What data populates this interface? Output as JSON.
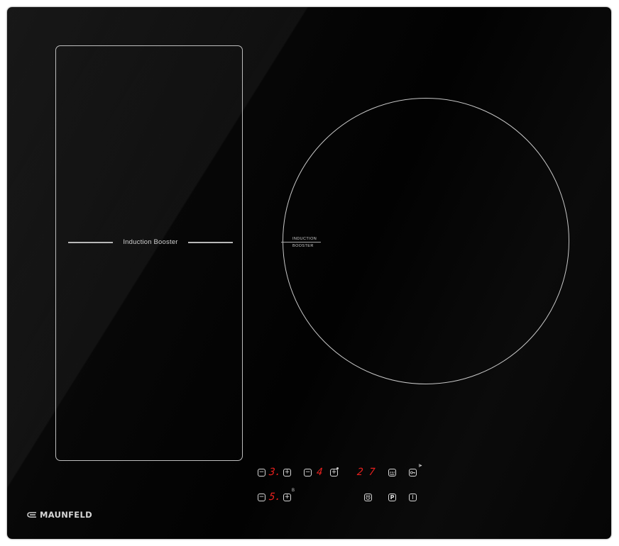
{
  "flex_zone": {
    "label": "Induction Booster"
  },
  "round_zone": {
    "label_line1": "INDUCTION",
    "label_line2": "BOOSTER"
  },
  "controls": {
    "minus_symbol": "−",
    "plus_symbol": "+",
    "zone1_level": "3.",
    "zone2_level": "4",
    "zone3_level": "5.",
    "timer_display": "2 7",
    "boost_marker": "B",
    "pause_symbol": "P",
    "power_symbol": "I"
  },
  "brand": {
    "name": "MAUNFELD"
  },
  "colors": {
    "glass": "#050505",
    "outline": "#c0c0c0",
    "display_red": "#e8201e"
  }
}
